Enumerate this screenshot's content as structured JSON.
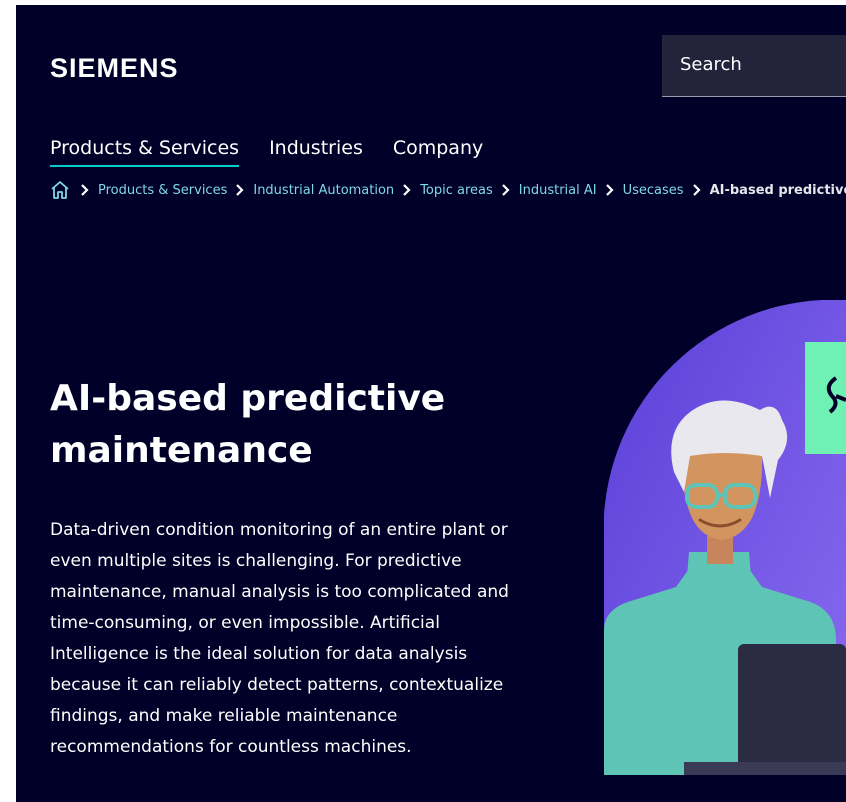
{
  "header": {
    "logo": "SIEMENS",
    "search": {
      "label": "Search"
    }
  },
  "nav": {
    "items": [
      {
        "label": "Products & Services",
        "active": true
      },
      {
        "label": "Industries",
        "active": false
      },
      {
        "label": "Company",
        "active": false
      }
    ]
  },
  "breadcrumb": {
    "items": [
      "Products & Services",
      "Industrial Automation",
      "Topic areas",
      "Industrial AI",
      "Usecases"
    ],
    "current": "AI-based predictive maintenance"
  },
  "hero": {
    "title_line1": "AI-based predictive",
    "title_line2": "maintenance",
    "description": "Data-driven condition monitoring of an entire plant or even multiple sites is challenging. For predictive maintenance, manual analysis is too complicated and time-consuming, or even impossible. Artificial Intelligence is the ideal solution for data analysis because it can reliably detect patterns, contextualize findings, and make reliable maintenance recommendations for countless machines."
  },
  "colors": {
    "background": "#000028",
    "accent": "#00cccc",
    "link": "#7fd8e6",
    "illustration_purple": "#6f55e0",
    "illustration_teal": "#5ec4b6",
    "illustration_green": "#6ff0b4"
  },
  "icons": {
    "home": "home-icon",
    "chevron": "chevron-right-icon"
  }
}
